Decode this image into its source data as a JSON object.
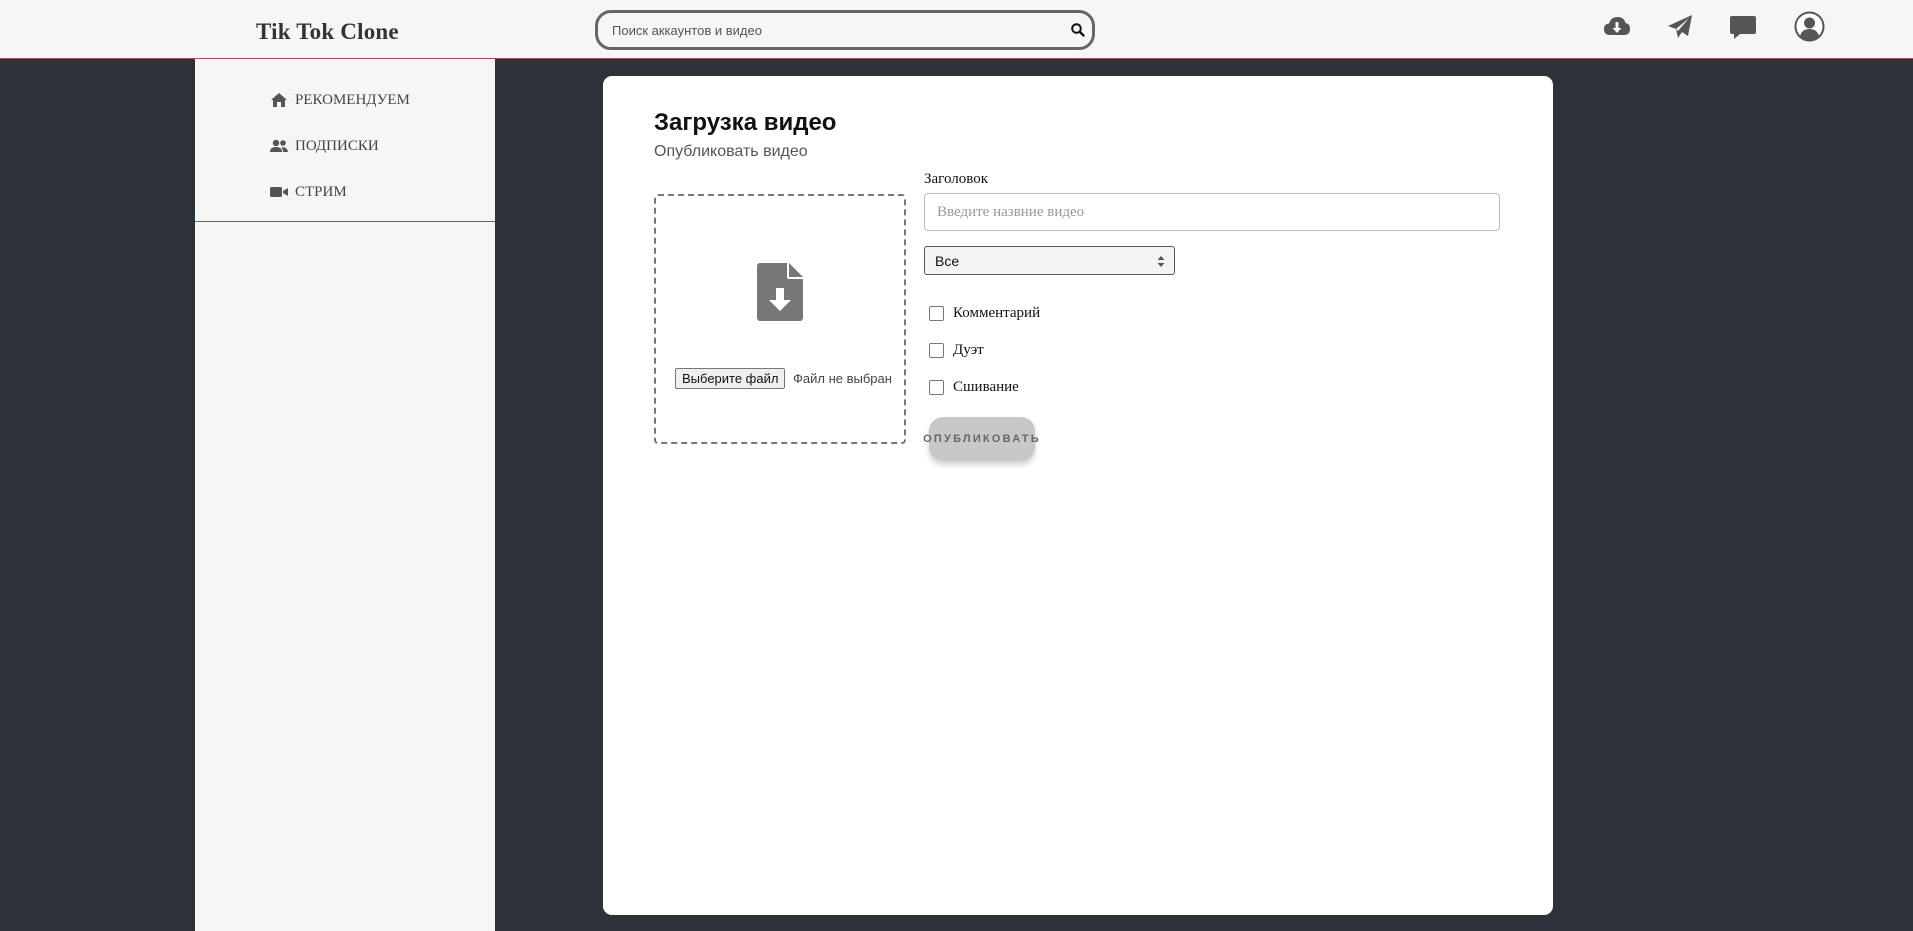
{
  "header": {
    "logo": "Tik Tok Clone",
    "search_placeholder": "Поиск аккаунтов и видео",
    "icons": [
      "cloud-download-icon",
      "paper-plane-icon",
      "comment-icon",
      "user-avatar-icon"
    ]
  },
  "sidebar": {
    "items": [
      {
        "label": "РЕКОМЕНДУЕМ",
        "icon": "home-icon"
      },
      {
        "label": "ПОДПИСКИ",
        "icon": "users-icon"
      },
      {
        "label": "СТРИМ",
        "icon": "video-camera-icon"
      }
    ]
  },
  "upload": {
    "title": "Загрузка видео",
    "subtitle": "Опубликовать видео",
    "file_button": "Выберите файл",
    "file_status": "Файл не выбран",
    "title_label": "Заголовок",
    "title_placeholder": "Введите назвние видео",
    "visibility_selected": "Все",
    "checkboxes": [
      {
        "label": "Комментарий",
        "checked": false
      },
      {
        "label": "Дуэт",
        "checked": false
      },
      {
        "label": "Сшивание",
        "checked": false
      }
    ],
    "publish_label": "ОПУБЛИКОВАТЬ"
  },
  "colors": {
    "background": "#2c3238",
    "panel": "#ffffff",
    "sidebar": "#f6f6f6",
    "accent_line": "#a05050"
  }
}
